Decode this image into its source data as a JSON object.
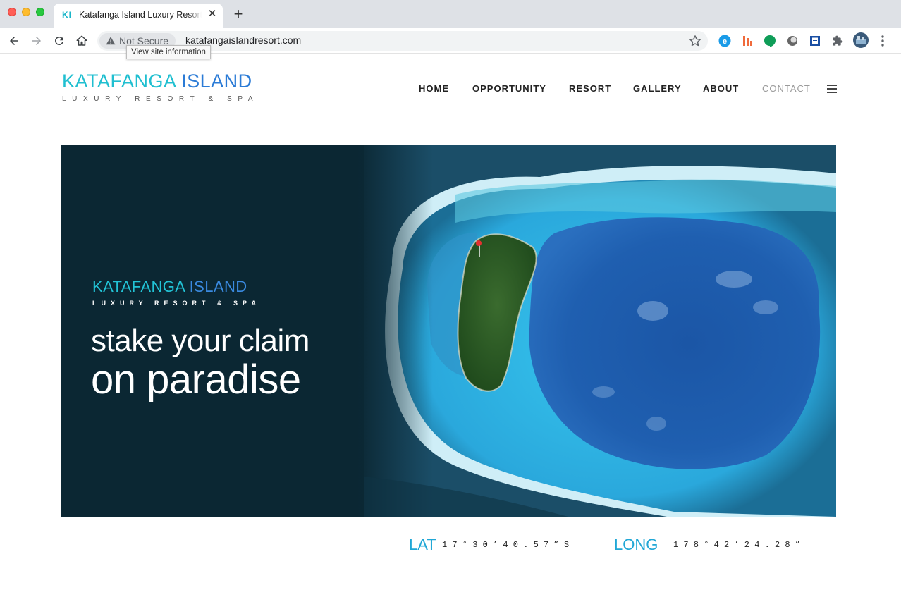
{
  "browser": {
    "tab_favicon": "KI",
    "tab_title": "Katafanga Island Luxury Resort & Spa",
    "tab_close": "✕",
    "new_tab": "+",
    "security_label": "Not Secure",
    "url": "katafangaislandresort.com",
    "tooltip": "View site information",
    "icons": [
      "back-icon",
      "forward-icon",
      "reload-icon",
      "home-icon",
      "warning-icon",
      "star-icon",
      "extension-icon",
      "puzzle-icon",
      "profile-avatar",
      "menu-dots-icon"
    ]
  },
  "site": {
    "logo": {
      "word1": "KATAFANGA",
      "word2": "ISLAND",
      "sub": "LUXURY RESORT & SPA"
    },
    "nav": [
      {
        "label": "HOME"
      },
      {
        "label": "OPPORTUNITY"
      },
      {
        "label": "RESORT"
      },
      {
        "label": "GALLERY"
      },
      {
        "label": "ABOUT"
      },
      {
        "label": "CONTACT"
      }
    ],
    "hero": {
      "logo_word1": "KATAFANGA",
      "logo_word2": "ISLAND",
      "logo_sub": "LUXURY RESORT & SPA",
      "line1": "stake your claim",
      "line2": "on paradise"
    },
    "coords": {
      "lat_label": "LAT",
      "lat_value": "17°30’40.57”S",
      "long_label": "LONG",
      "long_value": "178°42’24.28”"
    }
  },
  "colors": {
    "brand_cyan": "#20bfd0",
    "brand_blue": "#2b7bd6",
    "hero_bg": "#0b2733",
    "active_nav": "#9a9a9a"
  }
}
